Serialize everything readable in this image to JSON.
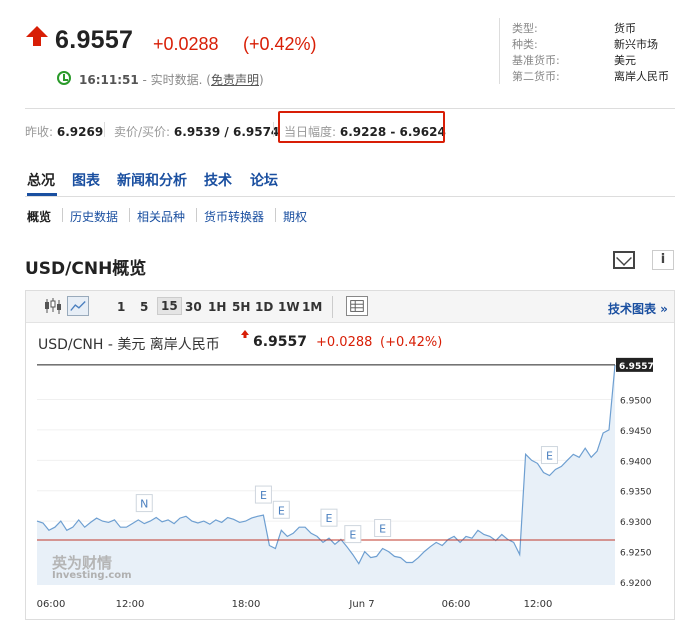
{
  "quote": {
    "price": "6.9557",
    "change": "+0.0288",
    "change_pct": "(+0.42%)"
  },
  "status": {
    "time": "16:11:51",
    "label": " - 实时数据. (",
    "disclaimer": "免责声明",
    "close": ")"
  },
  "side_info": [
    {
      "key": "类型:",
      "value": "货币"
    },
    {
      "key": "种类:",
      "value": "新兴市场"
    },
    {
      "key": "基准货币:",
      "value": "美元"
    },
    {
      "key": "第二货币:",
      "value": "离岸人民币"
    }
  ],
  "quote_row": {
    "prev_close_label": "昨收:",
    "prev_close": "6.9269",
    "bid_ask_label": "卖价/买价:",
    "bid_ask": "6.9539 / 6.9574",
    "day_range_label": "当日幅度:",
    "day_range": "6.9228 - 6.9624"
  },
  "tabs": [
    "总况",
    "图表",
    "新闻和分析",
    "技术",
    "论坛"
  ],
  "subtabs": [
    "概览",
    "历史数据",
    "相关品种",
    "货币转换器",
    "期权"
  ],
  "section_title": "USD/CNH概览",
  "toolbar": {
    "intervals": [
      "1",
      "5",
      "15",
      "30",
      "1H",
      "5H",
      "1D",
      "1W",
      "1M"
    ],
    "selected": "15",
    "tech_chart_link": "技术图表 »"
  },
  "chart_header": {
    "title": "USD/CNH - 美元 离岸人民币",
    "price": "6.9557",
    "change": "+0.0288",
    "change_pct": "(+0.42%)"
  },
  "watermark": {
    "line1": "英为财情",
    "line2": "Investing.com"
  },
  "colors": {
    "up_red": "#d81e06",
    "link_blue": "#1a4fa0",
    "area_fill": "#e8f0f8",
    "line": "#6e9fd1"
  },
  "icons": [
    "up-arrow-icon",
    "clock-icon",
    "mail-icon",
    "info-icon",
    "candlestick-icon",
    "line-chart-icon",
    "table-icon"
  ],
  "chart_data": {
    "type": "area",
    "x_tick_labels": [
      "06:00",
      "12:00",
      "18:00",
      "Jun 7",
      "06:00",
      "12:00"
    ],
    "y_tick_labels": [
      "6.9200",
      "6.9250",
      "6.9300",
      "6.9350",
      "6.9400",
      "6.9450",
      "6.9500",
      "6.9557"
    ],
    "ylim": [
      6.9195,
      6.9565
    ],
    "last_price": 6.9557,
    "reference_line": 6.9269,
    "n_points": 98,
    "values": [
      6.93,
      6.9297,
      6.9285,
      6.929,
      6.93,
      6.9285,
      6.929,
      6.9302,
      6.929,
      6.9298,
      6.9305,
      6.93,
      6.9298,
      6.9302,
      6.929,
      6.929,
      6.9296,
      6.9302,
      6.9296,
      6.93,
      6.9306,
      6.9299,
      6.9302,
      6.9296,
      6.9305,
      6.9308,
      6.93,
      6.9297,
      6.93,
      6.9295,
      6.9302,
      6.9298,
      6.9306,
      6.9303,
      6.9298,
      6.93,
      6.9305,
      6.9308,
      6.931,
      6.926,
      6.9255,
      6.9285,
      6.9275,
      6.928,
      6.929,
      6.929,
      6.928,
      6.9275,
      6.9265,
      6.9272,
      6.9262,
      6.927,
      6.9258,
      6.9245,
      6.923,
      6.925,
      6.924,
      6.9242,
      6.9255,
      6.925,
      6.9242,
      6.924,
      6.9232,
      6.9232,
      6.924,
      6.925,
      6.9258,
      6.9265,
      6.926,
      6.927,
      6.9275,
      6.9265,
      6.9275,
      6.9272,
      6.9285,
      6.9278,
      6.9275,
      6.9268,
      6.9278,
      6.927,
      6.9265,
      6.9245,
      6.941,
      6.94,
      6.9395,
      6.938,
      6.9375,
      6.9385,
      6.939,
      6.94,
      6.941,
      6.9405,
      6.942,
      6.9405,
      6.9415,
      6.9445,
      6.945,
      6.9557
    ],
    "event_markers": [
      {
        "label": "N",
        "index": 18
      },
      {
        "label": "E",
        "index": 38
      },
      {
        "label": "E",
        "index": 41
      },
      {
        "label": "E",
        "index": 49
      },
      {
        "label": "E",
        "index": 53
      },
      {
        "label": "E",
        "index": 58
      },
      {
        "label": "E",
        "index": 86
      }
    ]
  }
}
